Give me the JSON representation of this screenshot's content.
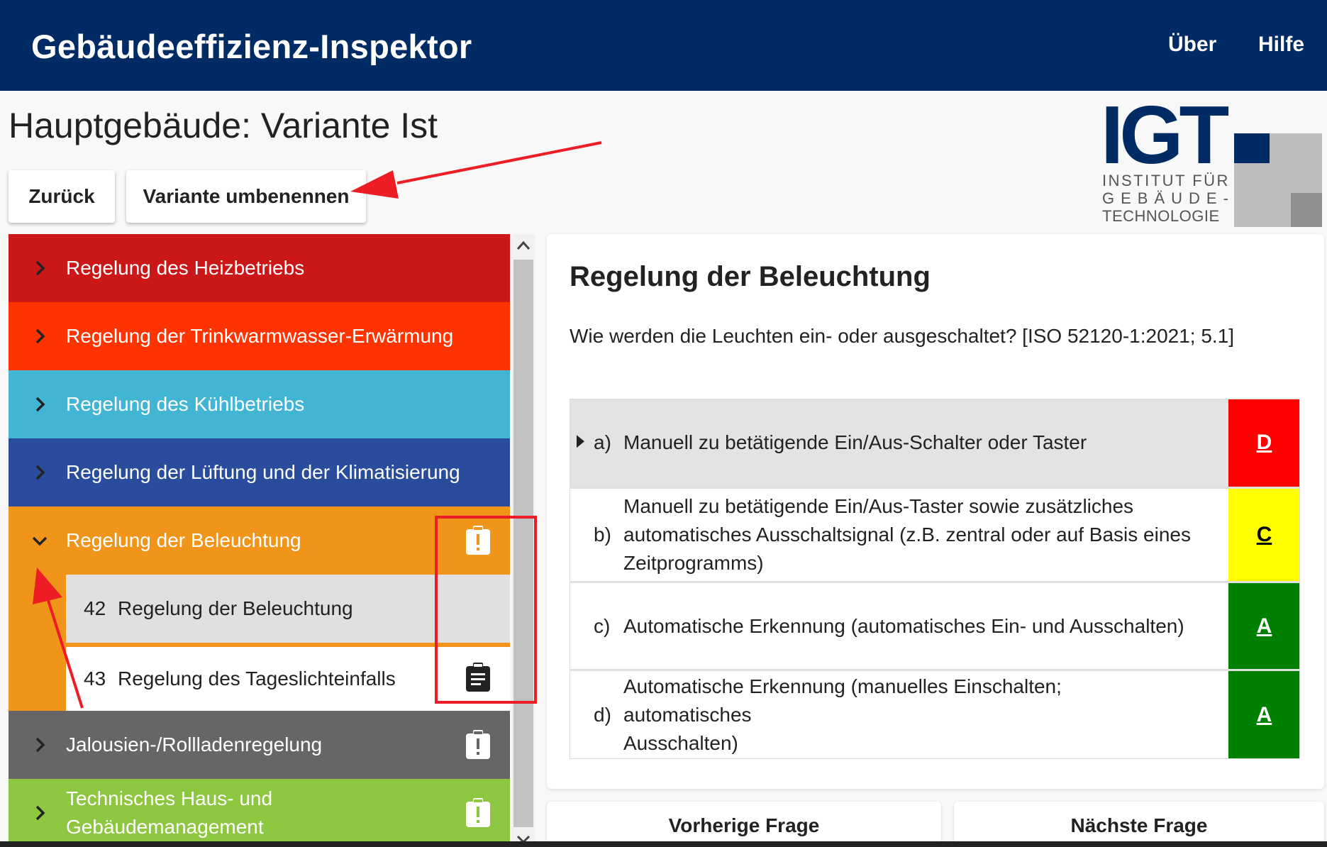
{
  "header": {
    "app_title": "Gebäudeeffizienz-Inspektor",
    "nav": [
      "Über",
      "Hilfe"
    ]
  },
  "page": {
    "title": "Hauptgebäude: Variante Ist",
    "back_label": "Zurück",
    "rename_label": "Variante umbenennen"
  },
  "logo": {
    "mark": "IGT",
    "line1": "INSTITUT FÜR",
    "line2": "GEBÄUDE-",
    "line3": "TECHNOLOGIE"
  },
  "sidebar": {
    "categories": [
      {
        "label": "Regelung des Heizbetriebs",
        "color": "#cc1719",
        "expanded": false
      },
      {
        "label": "Regelung der Trinkwarmwasser-Erwärmung",
        "color": "#ff3300",
        "expanded": false
      },
      {
        "label": "Regelung des Kühlbetriebs",
        "color": "#42b4d4",
        "expanded": false
      },
      {
        "label": "Regelung der Lüftung und der Klimatisierung",
        "color": "#2a4c9d",
        "expanded": false
      },
      {
        "label": "Regelung der Beleuchtung",
        "color": "#f0951a",
        "expanded": true,
        "icon": "clipboard-alert-icon"
      },
      {
        "label": "Jalousien-/Rollladenregelung",
        "color": "#666666",
        "expanded": false,
        "icon": "clipboard-alert-icon"
      },
      {
        "label_line1": "Technisches Haus- und",
        "label_line2": "Gebäudemanagement",
        "color": "#8dc63f",
        "expanded": false,
        "icon": "clipboard-alert-icon"
      }
    ],
    "subitems": [
      {
        "num": "42",
        "label": "Regelung der Beleuchtung",
        "active": true
      },
      {
        "num": "43",
        "label": "Regelung des Tageslichteinfalls",
        "active": false,
        "icon": "clipboard-list-icon"
      }
    ]
  },
  "question": {
    "title": "Regelung der Beleuchtung",
    "text": "Wie werden die Leuchten ein- oder ausgeschaltet? [ISO 52120-1:2021; 5.1]",
    "options": [
      {
        "letter": "a)",
        "text": "Manuell zu betätigende Ein/Aus-Schalter oder Taster",
        "grade": "D",
        "grade_color": "#ff0000",
        "grade_text_color": "#ffffff",
        "selected": true
      },
      {
        "letter": "b)",
        "text_lines": [
          "Manuell zu betätigende Ein/Aus-Taster sowie zusätzliches",
          "automatisches Ausschaltsignal (z.B. zentral oder auf Basis eines",
          "Zeitprogramms)"
        ],
        "grade": "C",
        "grade_color": "#ffff00",
        "grade_text_color": "#000000",
        "selected": false
      },
      {
        "letter": "c)",
        "text": "Automatische Erkennung (automatisches Ein- und Ausschalten)",
        "grade": "A",
        "grade_color": "#008000",
        "grade_text_color": "#ffffff",
        "selected": false
      },
      {
        "letter": "d)",
        "text_lines": [
          "Automatische Erkennung (manuelles Einschalten; automatisches",
          "Ausschalten)"
        ],
        "grade": "A",
        "grade_color": "#008000",
        "grade_text_color": "#ffffff",
        "selected": false
      }
    ]
  },
  "footer_nav": {
    "prev_label": "Vorherige Frage",
    "next_label": "Nächste Frage"
  },
  "colors": {
    "header_bg": "#002b64",
    "annotation_red": "#ee1c24",
    "selected_row": "#e3e3e3"
  }
}
